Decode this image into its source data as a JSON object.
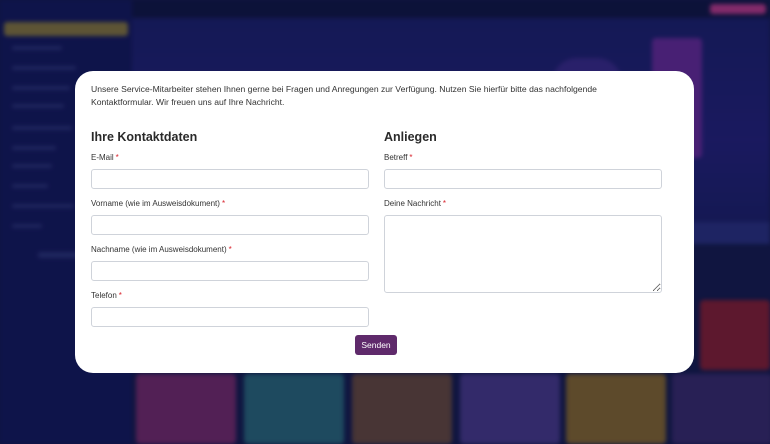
{
  "colors": {
    "accent_button": "#5f2a6b",
    "required_marker": "#d9232d",
    "modal_background": "#ffffff",
    "page_background": "#141a4a"
  },
  "modal": {
    "intro_text": "Unsere Service-Mitarbeiter stehen Ihnen gerne bei Fragen und Anregungen zur Verfügung. Nutzen Sie hierfür bitte das nachfolgende Kontaktformular. Wir freuen uns auf Ihre Nachricht.",
    "left_section": {
      "title": "Ihre Kontaktdaten",
      "fields": [
        {
          "label": "E-Mail",
          "required_mark": "*",
          "value": ""
        },
        {
          "label": "Vorname (wie im Ausweisdokument)",
          "required_mark": "*",
          "value": ""
        },
        {
          "label": "Nachname (wie im Ausweisdokument)",
          "required_mark": "*",
          "value": ""
        },
        {
          "label": "Telefon",
          "required_mark": "*",
          "value": ""
        }
      ]
    },
    "right_section": {
      "title": "Anliegen",
      "fields": [
        {
          "label": "Betreff",
          "required_mark": "*",
          "value": ""
        },
        {
          "label": "Deine Nachricht",
          "required_mark": "*",
          "value": ""
        }
      ]
    },
    "submit_label": "Senden"
  }
}
